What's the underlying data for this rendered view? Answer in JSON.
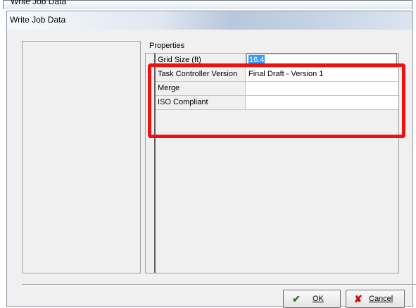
{
  "background_window": {
    "title": "Write Job Data"
  },
  "dialog": {
    "title": "Write Job Data"
  },
  "properties": {
    "label": "Properties",
    "rows": [
      {
        "name": "Grid Size (ft)",
        "value": "16.4"
      },
      {
        "name": "Task Controller Version",
        "value": "Final Draft - Version 1"
      },
      {
        "name": "Merge",
        "value": ""
      },
      {
        "name": "ISO Compliant",
        "value": ""
      }
    ]
  },
  "buttons": {
    "ok_label": "OK",
    "cancel_label": "Cancel"
  },
  "icons": {
    "ok": "checkmark-icon",
    "cancel": "x-cross-icon"
  },
  "colors": {
    "annotation_highlight": "#ee1111",
    "selection": "#3399ff",
    "ok_check": "#2a7a1a",
    "cancel_x": "#cc0000"
  }
}
